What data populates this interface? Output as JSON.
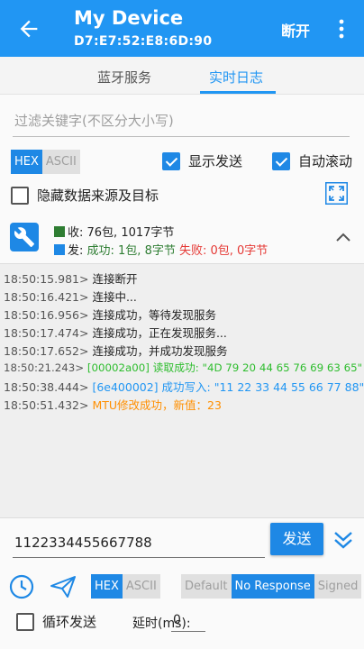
{
  "appbar": {
    "title": "My Device",
    "subtitle": "D7:E7:52:E8:6D:90",
    "disconnect_label": "断开"
  },
  "tabs": [
    {
      "label": "蓝牙服务",
      "active": false
    },
    {
      "label": "实时日志",
      "active": true
    }
  ],
  "filter": {
    "placeholder": "过滤关键字(不区分大小写)"
  },
  "display_format": {
    "options": [
      "HEX",
      "ASCII"
    ],
    "selected": "HEX"
  },
  "options": {
    "show_sent": {
      "label": "显示发送",
      "checked": true
    },
    "auto_scroll": {
      "label": "自动滚动",
      "checked": true
    },
    "hide_source": {
      "label": "隐藏数据来源及目标",
      "checked": false
    }
  },
  "stats": {
    "recv_prefix": "收: ",
    "recv_value": "76包, 1017字节",
    "send_prefix": "发: ",
    "send_success": "成功: 1包, 8字节",
    "send_fail": "失败: 0包, 0字节"
  },
  "logs": [
    {
      "time": "18:50:15.981>",
      "text": "连接断开",
      "color": "default"
    },
    {
      "time": "18:50:16.421>",
      "text": "连接中...",
      "color": "default"
    },
    {
      "time": "18:50:16.956>",
      "text": "连接成功，等待发现服务",
      "color": "default"
    },
    {
      "time": "18:50:17.474>",
      "text": "连接成功，正在发现服务...",
      "color": "default"
    },
    {
      "time": "18:50:17.652>",
      "text": "连接成功，并成功发现服务",
      "color": "default"
    },
    {
      "time": "18:50:21.243>",
      "text": "[00002a00] 读取成功: \"4D 79 20 44 65 76 69 63 65\"",
      "color": "green"
    },
    {
      "time": "18:50:38.444>",
      "text": "[6e400002] 成功写入: \"11 22 33 44 55 66 77 88\"",
      "color": "blue"
    },
    {
      "time": "18:50:51.432>",
      "text": "MTU修改成功，新值：23",
      "color": "orange"
    }
  ],
  "send": {
    "input_value": "1122334455667788",
    "button_label": "发送",
    "format_options": [
      "HEX",
      "ASCII"
    ],
    "format_selected": "HEX",
    "write_options": [
      "Default",
      "No Response",
      "Signed"
    ],
    "write_selected": "No Response",
    "loop_label": "循环发送",
    "loop_checked": false,
    "delay_label": "延时(ms):",
    "delay_value": "0"
  },
  "colors": {
    "primary": "#2196f3",
    "success_green": "#2e7d32",
    "fail_red": "#e53935",
    "read_green": "#2ebd2e",
    "mtu_orange": "#ff8f00"
  },
  "icons": [
    "back-arrow-icon",
    "more-vert-icon",
    "fullscreen-icon",
    "wrench-icon",
    "chevron-up-icon",
    "double-chevron-down-icon",
    "clock-icon",
    "paper-plane-icon"
  ]
}
